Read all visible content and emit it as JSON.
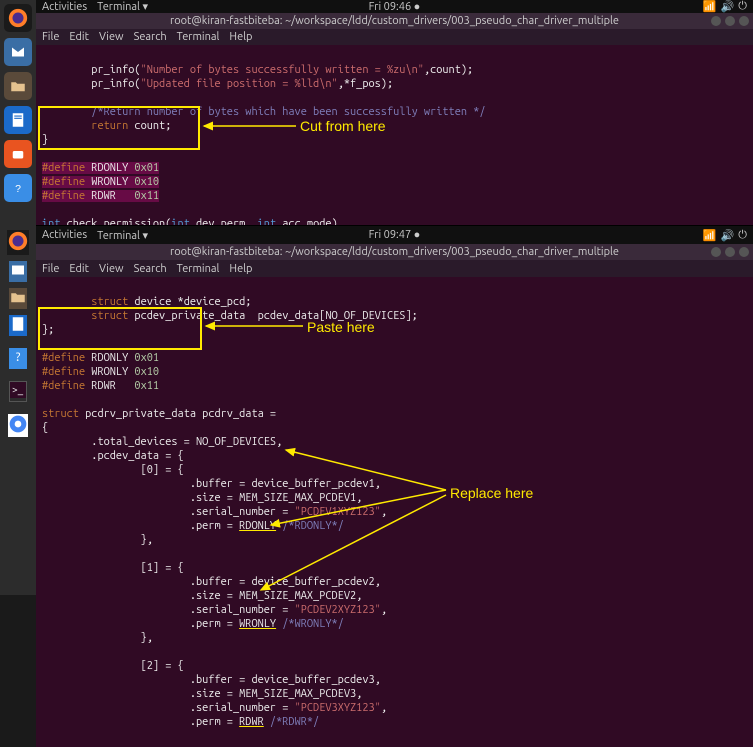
{
  "topbar1": {
    "activities": "Activities",
    "terminal": "Terminal ▾",
    "clock": "Fri 09:46 ●"
  },
  "topbar2": {
    "activities": "Activities",
    "terminal": "Terminal ▾",
    "clock": "Fri 09:47 ●"
  },
  "titlebar": "root@kiran-fastbiteba: ~/workspace/ldd/custom_drivers/003_pseudo_char_driver_multiple",
  "menu": {
    "file": "File",
    "edit": "Edit",
    "view": "View",
    "search": "Search",
    "terminal": "Terminal",
    "help": "Help"
  },
  "pane1": {
    "l1a": "pr_info(",
    "l1b": "\"Number of bytes successfully written = %zu\\n\"",
    "l1c": ",count);",
    "l2a": "pr_info(",
    "l2b": "\"Updated file position = %lld\\n\"",
    "l2c": ",*f_pos);",
    "l3": "/*Return number of bytes which have been successfully written */",
    "l4": "return",
    "l4b": " count;",
    "l5": "}",
    "d1a": "#define",
    "d1b": " RDONLY ",
    "d1c": "0x01",
    "d2a": "#define",
    "d2b": " WRONLY ",
    "d2c": "0x10",
    "d3a": "#define",
    "d3b": " RDWR   ",
    "d3c": "0x11",
    "fn1a": "int ",
    "fn1b": "check_permission(",
    "fn1c": "int",
    "fn1d": " dev_perm, ",
    "fn1e": "int",
    "fn1f": " acc_mode)",
    "fn2": "{",
    "end": "}"
  },
  "pane2": {
    "s1": "struct",
    "s1b": " device *device_pcd;",
    "s2": "struct",
    "s2b": " pcdev_private_data  pcdev_data[NO_OF_DEVICES];",
    "s3": "};",
    "d1a": "#define",
    "d1b": " RDONLY ",
    "d1c": "0x01",
    "d2a": "#define",
    "d2b": " WRONLY ",
    "d2c": "0x10",
    "d3a": "#define",
    "d3b": " RDWR   ",
    "d3c": "0x11",
    "st1": "struct",
    "st1b": " pcdrv_private_data pcdrv_data =",
    "st2": "{",
    "t1": ".total_devices = NO_OF_DEVICES,",
    "t2": ".pcdev_data = {",
    "i0": "[0] = {",
    "i0b": ".buffer = device_buffer_pcdev1,",
    "i0c": ".size = MEM_SIZE_MAX_PCDEV1,",
    "i0d1": ".serial_number = ",
    "i0d2": "\"PCDEV1XYZ123\"",
    "i0d3": ",",
    "i0e1": ".perm = ",
    "i0e2": "RDONLY",
    "i0e3": " /*RDONLY*/",
    "cb": "},",
    "i1": "[1] = {",
    "i1b": ".buffer = device_buffer_pcdev2,",
    "i1c": ".size = MEM_SIZE_MAX_PCDEV2,",
    "i1d1": ".serial_number = ",
    "i1d2": "\"PCDEV2XYZ123\"",
    "i1d3": ",",
    "i1e1": ".perm = ",
    "i1e2": "WRONLY",
    "i1e3": " /*WRONLY*/",
    "i2": "[2] = {",
    "i2b": ".buffer = device_buffer_pcdev3,",
    "i2c": ".size = MEM_SIZE_MAX_PCDEV3,",
    "i2d1": ".serial_number = ",
    "i2d2": "\"PCDEV3XYZ123\"",
    "i2d3": ",",
    "i2e1": ".perm = ",
    "i2e2": "RDWR",
    "i2e3": " /*RDWR*/"
  },
  "anno": {
    "cut": "Cut from here",
    "paste": "Paste here",
    "replace": "Replace here"
  },
  "icons": {
    "firefox": "firefox-icon",
    "mail": "mail-icon",
    "files": "files-icon",
    "store": "store-icon",
    "help": "help-icon",
    "settings": "settings-icon",
    "term": "terminal-icon",
    "inkscape": "inkscape-icon",
    "chrome": "chrome-icon",
    "writer": "writer-icon"
  }
}
